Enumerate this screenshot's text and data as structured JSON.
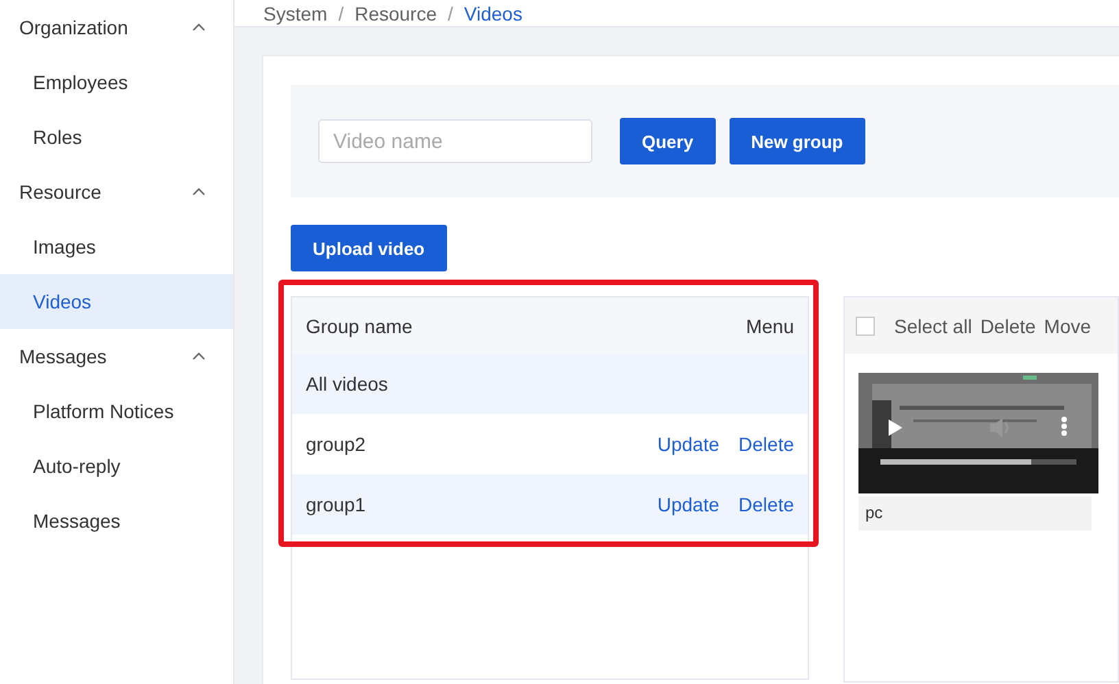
{
  "sidebar": {
    "items": [
      {
        "label": "Organization",
        "expanded": true,
        "children": [
          {
            "label": "Employees",
            "selected": false
          },
          {
            "label": "Roles",
            "selected": false
          }
        ]
      },
      {
        "label": "Resource",
        "expanded": true,
        "children": [
          {
            "label": "Images",
            "selected": false
          },
          {
            "label": "Videos",
            "selected": true
          }
        ]
      },
      {
        "label": "Messages",
        "expanded": true,
        "children": [
          {
            "label": "Platform Notices",
            "selected": false
          },
          {
            "label": "Auto-reply",
            "selected": false
          },
          {
            "label": "Messages",
            "selected": false
          }
        ]
      }
    ]
  },
  "breadcrumb": {
    "items": [
      "System",
      "Resource",
      "Videos"
    ],
    "separators": [
      "/",
      "/"
    ]
  },
  "search": {
    "placeholder": "Video name"
  },
  "query_buttons": [
    "Query",
    "New group"
  ],
  "upload_button": "Upload video",
  "groups": {
    "columns": [
      "Group name",
      "Menu"
    ],
    "rows": [
      {
        "name": "All videos",
        "actions": []
      },
      {
        "name": "group2",
        "actions": [
          "Update",
          "Delete"
        ]
      },
      {
        "name": "group1",
        "actions": [
          "Update",
          "Delete"
        ]
      }
    ]
  },
  "videos": {
    "select_all": {
      "label": "Select all",
      "checked": false
    },
    "actions": [
      "Delete",
      "Move"
    ],
    "items": [
      {
        "caption": "pc",
        "progress": {
          "level": 0.77
        }
      }
    ]
  }
}
